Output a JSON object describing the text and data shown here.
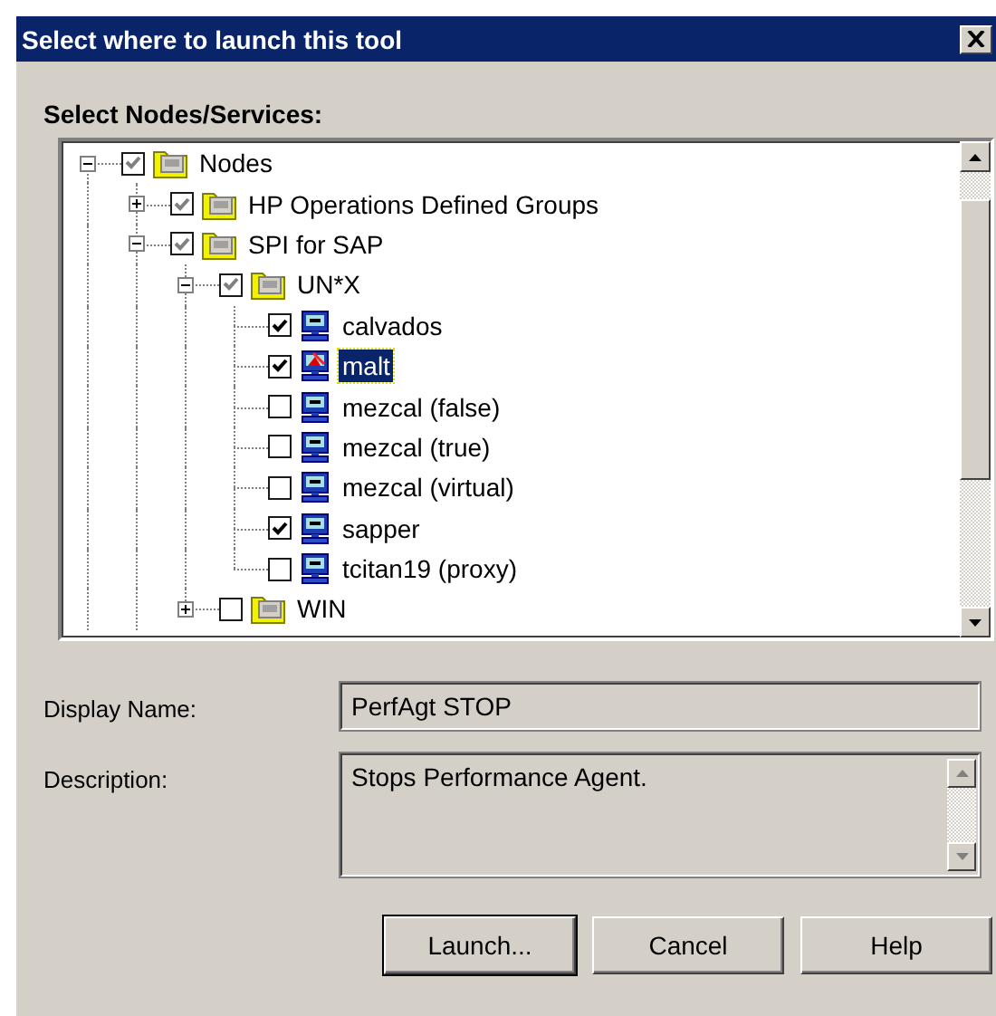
{
  "window": {
    "title": "Select where to launch this tool"
  },
  "tree": {
    "label": "Select Nodes/Services:",
    "items": [
      {
        "label": "Nodes",
        "kind": "group",
        "checked": true,
        "greyed": true,
        "expanded": true,
        "continues": true,
        "selected": false,
        "children": [
          {
            "label": "HP Operations Defined Groups",
            "kind": "group",
            "checked": true,
            "greyed": true,
            "expanded": false,
            "selected": false
          },
          {
            "label": "SPI for SAP",
            "kind": "group",
            "checked": true,
            "greyed": true,
            "expanded": true,
            "continues": true,
            "selected": false,
            "children": [
              {
                "label": "UN*X",
                "kind": "group",
                "checked": true,
                "greyed": true,
                "expanded": true,
                "selected": false,
                "children": [
                  {
                    "label": "calvados",
                    "kind": "node",
                    "checked": true,
                    "selected": false
                  },
                  {
                    "label": "malt",
                    "kind": "node-alert",
                    "checked": true,
                    "selected": true
                  },
                  {
                    "label": "mezcal (false)",
                    "kind": "node",
                    "checked": false,
                    "selected": false
                  },
                  {
                    "label": "mezcal (true)",
                    "kind": "node",
                    "checked": false,
                    "selected": false
                  },
                  {
                    "label": "mezcal (virtual)",
                    "kind": "node",
                    "checked": false,
                    "selected": false
                  },
                  {
                    "label": "sapper",
                    "kind": "node",
                    "checked": true,
                    "selected": false
                  },
                  {
                    "label": "tcitan19 (proxy)",
                    "kind": "node",
                    "checked": false,
                    "selected": false
                  }
                ]
              },
              {
                "label": "WIN",
                "kind": "group",
                "checked": false,
                "expanded": false,
                "selected": false
              }
            ]
          }
        ]
      }
    ]
  },
  "fields": [
    {
      "label": "Display Name:",
      "value": "PerfAgt STOP",
      "kind": "line"
    },
    {
      "label": "Description:",
      "value": "Stops Performance Agent.",
      "kind": "multiline"
    }
  ],
  "buttons": [
    {
      "label": "Launch...",
      "default": true
    },
    {
      "label": "Cancel",
      "default": false
    },
    {
      "label": "Help",
      "default": false
    }
  ]
}
